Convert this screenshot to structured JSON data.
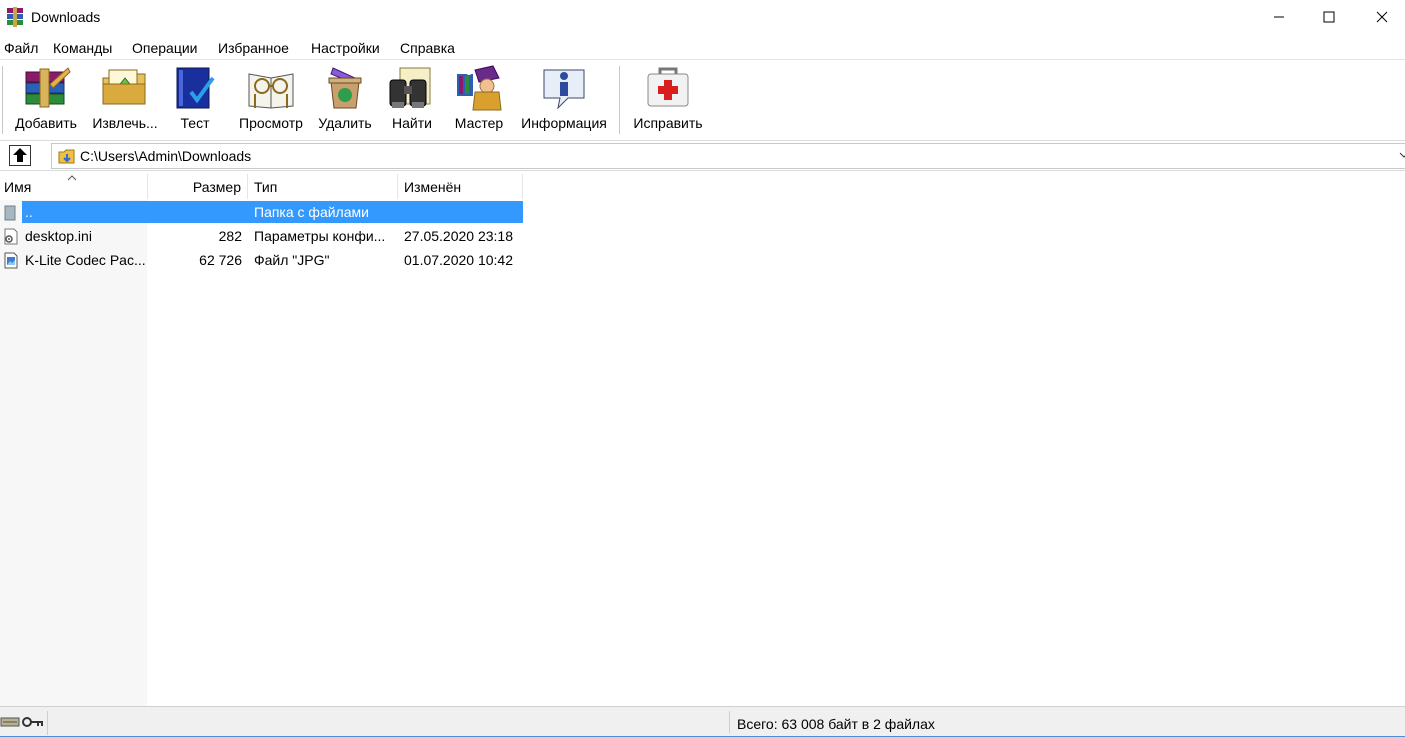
{
  "window": {
    "title": "Downloads",
    "app_icon": "winrar-books-icon"
  },
  "menu": [
    "Файл",
    "Команды",
    "Операции",
    "Избранное",
    "Настройки",
    "Справка"
  ],
  "toolbar": {
    "add": "Добавить",
    "extract": "Извлечь...",
    "test": "Тест",
    "view": "Просмотр",
    "delete": "Удалить",
    "find": "Найти",
    "wizard": "Мастер",
    "info": "Информация",
    "repair": "Исправить"
  },
  "address": {
    "path": "C:\\Users\\Admin\\Downloads"
  },
  "columns": {
    "name": "Имя",
    "size": "Размер",
    "type": "Тип",
    "modified": "Изменён"
  },
  "files": [
    {
      "name": "..",
      "size": "",
      "type": "Папка с файлами",
      "modified": "",
      "icon": "parent-folder-icon",
      "selected": true
    },
    {
      "name": "desktop.ini",
      "size": "282",
      "type": "Параметры конфи...",
      "modified": "27.05.2020 23:18",
      "icon": "settings-file-icon",
      "selected": false
    },
    {
      "name": "K-Lite Codec Pac...",
      "size": "62 726",
      "type": "Файл \"JPG\"",
      "modified": "01.07.2020 10:42",
      "icon": "image-file-icon",
      "selected": false
    }
  ],
  "status": {
    "total": "Всего: 63 008 байт в 2 файлах"
  },
  "colors": {
    "selection": "#3399ff",
    "status_bar": "#f0f0f0",
    "name_column": "#f7f7f7"
  }
}
